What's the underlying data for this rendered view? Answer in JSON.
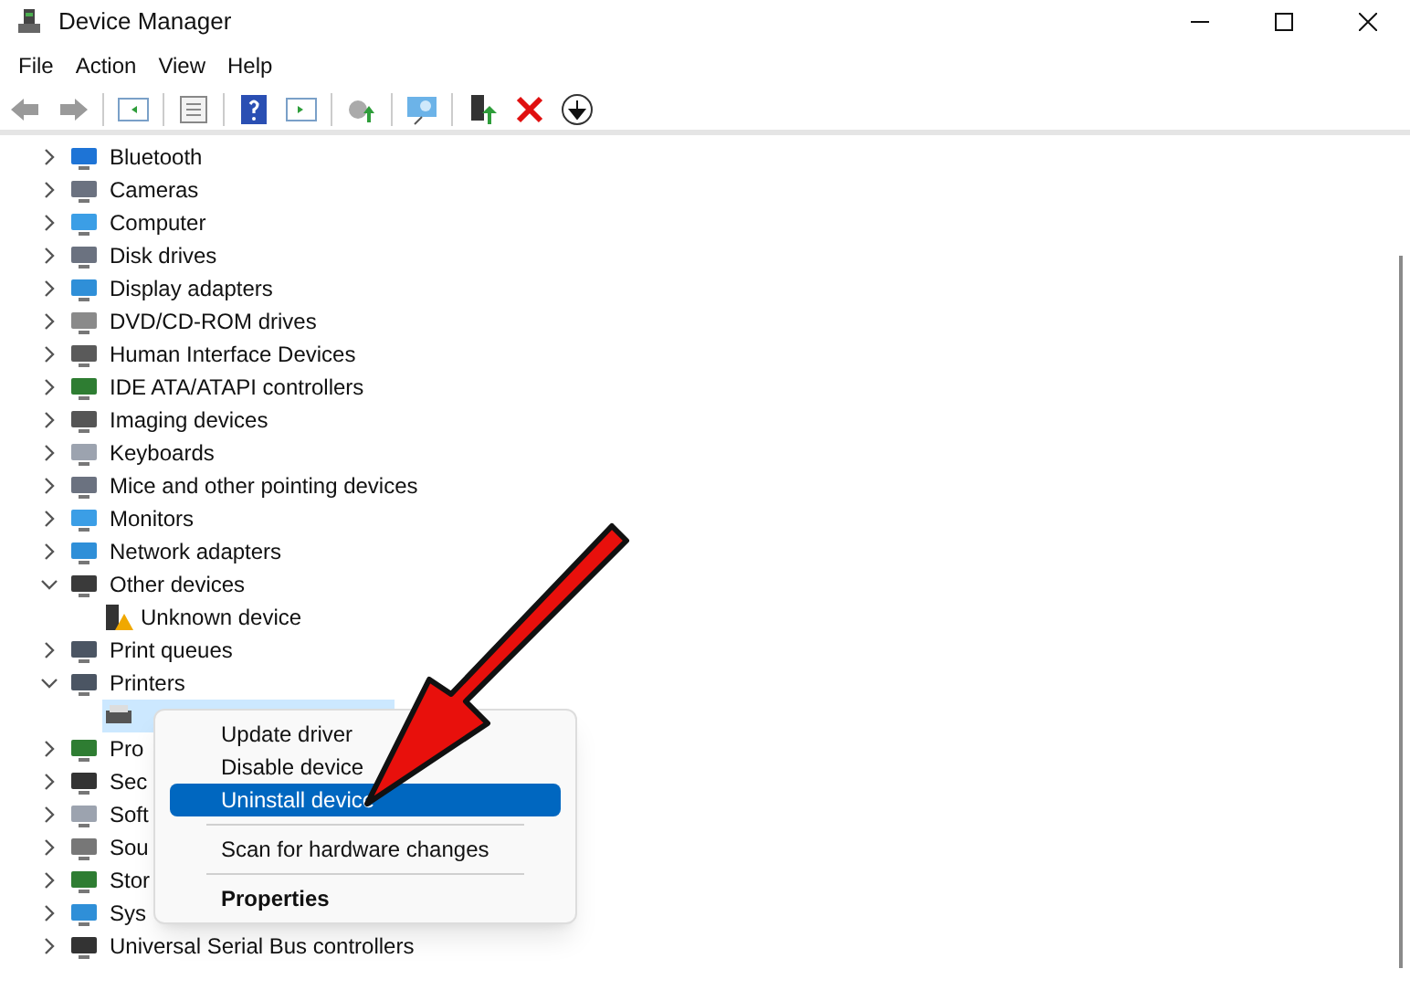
{
  "window": {
    "title": "Device Manager"
  },
  "menu_bar": [
    "File",
    "Action",
    "View",
    "Help"
  ],
  "tree": [
    {
      "label": "Bluetooth",
      "expanded": false
    },
    {
      "label": "Cameras",
      "expanded": false
    },
    {
      "label": "Computer",
      "expanded": false
    },
    {
      "label": "Disk drives",
      "expanded": false
    },
    {
      "label": "Display adapters",
      "expanded": false
    },
    {
      "label": "DVD/CD-ROM drives",
      "expanded": false
    },
    {
      "label": "Human Interface Devices",
      "expanded": false
    },
    {
      "label": "IDE ATA/ATAPI controllers",
      "expanded": false
    },
    {
      "label": "Imaging devices",
      "expanded": false
    },
    {
      "label": "Keyboards",
      "expanded": false
    },
    {
      "label": "Mice and other pointing devices",
      "expanded": false
    },
    {
      "label": "Monitors",
      "expanded": false
    },
    {
      "label": "Network adapters",
      "expanded": false
    },
    {
      "label": "Other devices",
      "expanded": true,
      "children": [
        {
          "label": "Unknown device",
          "selected": false,
          "warning": true
        }
      ]
    },
    {
      "label": "Print queues",
      "expanded": false
    },
    {
      "label": "Printers",
      "expanded": true,
      "children": [
        {
          "selected": true,
          "warning": false
        }
      ]
    },
    {
      "label": "Pro",
      "expanded": false
    },
    {
      "label": "Sec",
      "expanded": false
    },
    {
      "label": "Soft",
      "expanded": false
    },
    {
      "label": "Sou",
      "expanded": false
    },
    {
      "label": "Stor",
      "expanded": false
    },
    {
      "label": "Sys",
      "expanded": false
    },
    {
      "label": "Universal Serial Bus controllers",
      "expanded": false
    }
  ],
  "context_menu": [
    {
      "kind": "item",
      "label": "Update driver",
      "selected": false
    },
    {
      "kind": "item",
      "label": "Disable device",
      "selected": false
    },
    {
      "kind": "item",
      "label": "Uninstall device",
      "selected": true
    },
    {
      "kind": "separator"
    },
    {
      "kind": "item",
      "label": "Scan for hardware changes",
      "selected": false
    },
    {
      "kind": "separator"
    },
    {
      "kind": "default",
      "label": "Properties",
      "selected": false
    }
  ]
}
